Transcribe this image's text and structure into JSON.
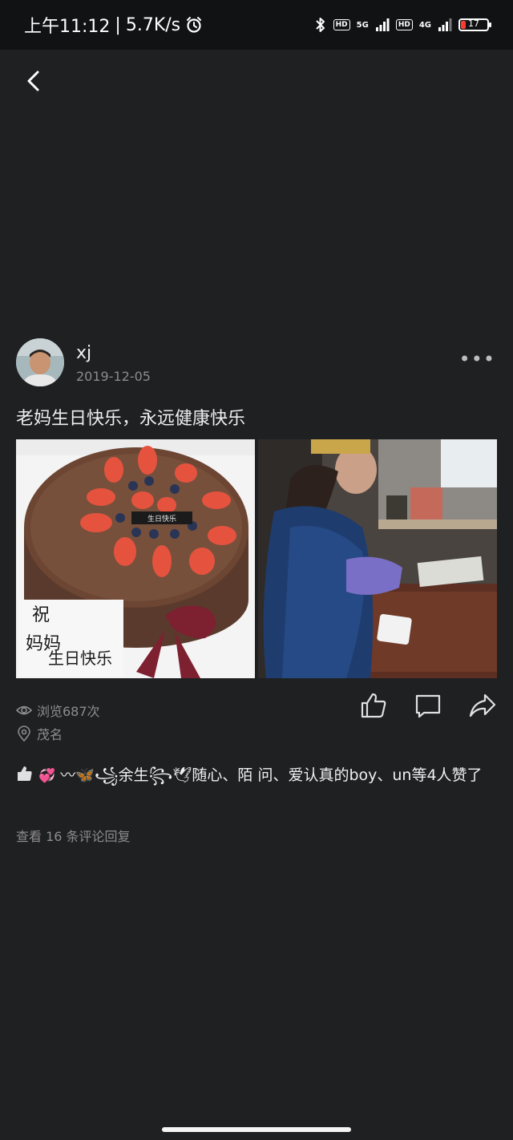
{
  "status_bar": {
    "time": "上午11:12",
    "separator": "|",
    "speed": "5.7K/s",
    "hd1": "HD",
    "net1": "5G",
    "hd2": "HD",
    "net2": "4G",
    "battery": "17"
  },
  "post": {
    "username": "xj",
    "date": "2019-12-05",
    "text": "老妈生日快乐，永远健康快乐",
    "photos": [
      {
        "cake_tag": "生日快乐",
        "handwriting_1": "祝",
        "handwriting_2": "妈妈",
        "handwriting_3": "生日快乐"
      },
      {}
    ],
    "views": "浏览687次",
    "location": "茂名"
  },
  "likes": {
    "text": "〰🦋꧁余生꧂🕊随心、陌  问、爱认真的boy、un等4人赞了",
    "emoji_heart": "💞"
  },
  "comments_link": "查看 16 条评论回复",
  "icons": [
    "back-arrow-icon",
    "more-icon",
    "eye-icon",
    "location-pin-icon",
    "thumbs-up-icon",
    "comment-icon",
    "share-icon"
  ],
  "colors": {
    "background": "#1f2022",
    "status_bar": "#111213",
    "muted_text": "#8d8d8d",
    "battery_low": "#ff3b30"
  }
}
